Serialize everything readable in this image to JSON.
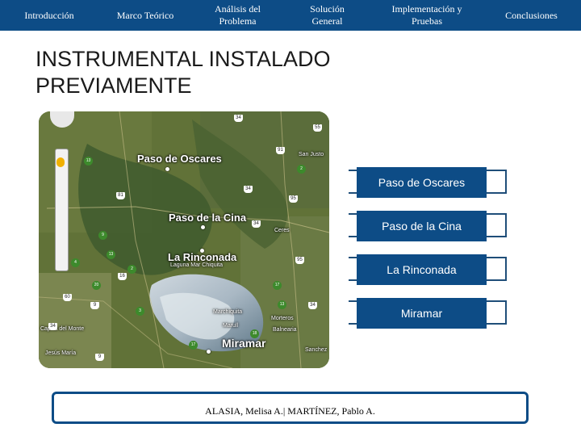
{
  "nav": {
    "tabs": [
      {
        "label": "Introducción"
      },
      {
        "label": "Marco Teórico"
      },
      {
        "label": "Análisis del Problema"
      },
      {
        "label": "Solución General"
      },
      {
        "label": "Implementación y Pruebas"
      },
      {
        "label": "Conclusiones"
      }
    ]
  },
  "title": "INSTRUMENTAL INSTALADO PREVIAMENTE",
  "map": {
    "places": {
      "paso_de_oscares": "Paso de Oscares",
      "paso_de_la_cina": "Paso de la Cina",
      "la_rinconada": "La Rinconada",
      "miramar": "Miramar",
      "laguna_mar_chiquita": "Laguna Mar Chiquita",
      "marchiquita": "Marchiquita",
      "ceres": "Ceres",
      "san_justo": "San Justo",
      "monte_maiz": "Morteros",
      "balnearia": "Balnearia",
      "capilla": "Capilla del Monte",
      "jesus_maria": "Jesús María",
      "marull": "Marull",
      "san_jose": "Sanchez"
    },
    "road_shields": [
      "34",
      "55",
      "91",
      "95",
      "81",
      "34",
      "95",
      "34",
      "60",
      "9",
      "34",
      "16",
      "34",
      "9"
    ],
    "route_circles": [
      "2",
      "13",
      "4",
      "2",
      "13",
      "20",
      "3",
      "17",
      "13",
      "9",
      "17",
      "18"
    ]
  },
  "stations": [
    {
      "label": "Paso de Oscares"
    },
    {
      "label": "Paso de la Cina"
    },
    {
      "label": "La Rinconada"
    },
    {
      "label": "Miramar"
    }
  ],
  "footer": {
    "text": "ALASIA, Melisa A.| MARTÍNEZ, Pablo A."
  },
  "colors": {
    "accent": "#0d4c86",
    "box_border": "#1f4e79"
  }
}
